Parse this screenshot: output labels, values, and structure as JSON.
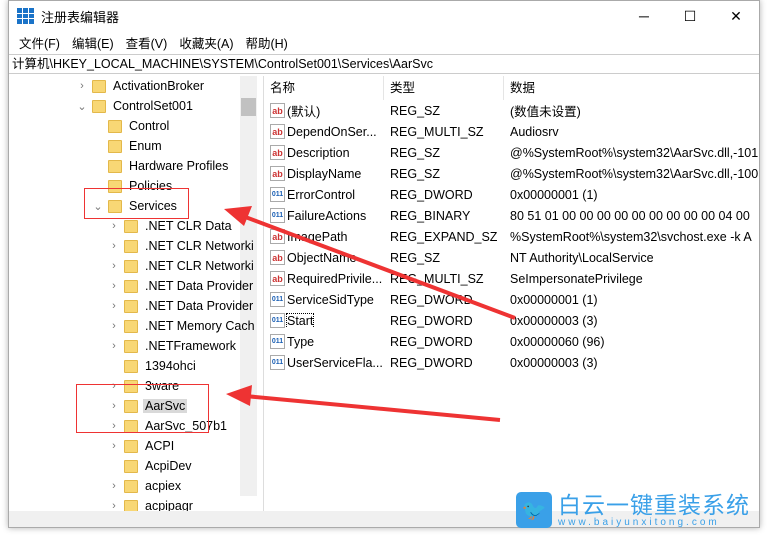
{
  "window": {
    "title": "注册表编辑器",
    "minimize": "─",
    "maximize": "☐",
    "close": "✕"
  },
  "menu": [
    "文件(F)",
    "编辑(E)",
    "查看(V)",
    "收藏夹(A)",
    "帮助(H)"
  ],
  "address": "计算机\\HKEY_LOCAL_MACHINE\\SYSTEM\\ControlSet001\\Services\\AarSvc",
  "tree": [
    {
      "label": "ActivationBroker",
      "level": 0,
      "expander": "collapsed"
    },
    {
      "label": "ControlSet001",
      "level": 0,
      "expander": "expanded"
    },
    {
      "label": "Control",
      "level": 1,
      "expander": "none"
    },
    {
      "label": "Enum",
      "level": 1,
      "expander": "none"
    },
    {
      "label": "Hardware Profiles",
      "level": 1,
      "expander": "none"
    },
    {
      "label": "Policies",
      "level": 1,
      "expander": "none"
    },
    {
      "label": "Services",
      "level": 1,
      "expander": "expanded"
    },
    {
      "label": ".NET CLR Data",
      "level": 2,
      "expander": "collapsed"
    },
    {
      "label": ".NET CLR Networki",
      "level": 2,
      "expander": "collapsed"
    },
    {
      "label": ".NET CLR Networki",
      "level": 2,
      "expander": "collapsed"
    },
    {
      "label": ".NET Data Provider",
      "level": 2,
      "expander": "collapsed"
    },
    {
      "label": ".NET Data Provider",
      "level": 2,
      "expander": "collapsed"
    },
    {
      "label": ".NET Memory Cach",
      "level": 2,
      "expander": "collapsed"
    },
    {
      "label": ".NETFramework",
      "level": 2,
      "expander": "collapsed"
    },
    {
      "label": "1394ohci",
      "level": 2,
      "expander": "none"
    },
    {
      "label": "3ware",
      "level": 2,
      "expander": "collapsed"
    },
    {
      "label": "AarSvc",
      "level": 2,
      "expander": "collapsed",
      "selected": true
    },
    {
      "label": "AarSvc_507b1",
      "level": 2,
      "expander": "collapsed"
    },
    {
      "label": "ACPI",
      "level": 2,
      "expander": "collapsed"
    },
    {
      "label": "AcpiDev",
      "level": 2,
      "expander": "none"
    },
    {
      "label": "acpiex",
      "level": 2,
      "expander": "collapsed"
    },
    {
      "label": "acpipagr",
      "level": 2,
      "expander": "collapsed"
    }
  ],
  "list": {
    "headers": [
      "名称",
      "类型",
      "数据"
    ],
    "rows": [
      {
        "icon": "string-value-icon",
        "name": "(默认)",
        "type": "REG_SZ",
        "data": "(数值未设置)"
      },
      {
        "icon": "string-value-icon",
        "name": "DependOnSer...",
        "type": "REG_MULTI_SZ",
        "data": "Audiosrv"
      },
      {
        "icon": "string-value-icon",
        "name": "Description",
        "type": "REG_SZ",
        "data": "@%SystemRoot%\\system32\\AarSvc.dll,-101"
      },
      {
        "icon": "string-value-icon",
        "name": "DisplayName",
        "type": "REG_SZ",
        "data": "@%SystemRoot%\\system32\\AarSvc.dll,-100"
      },
      {
        "icon": "binary-value-icon",
        "name": "ErrorControl",
        "type": "REG_DWORD",
        "data": "0x00000001 (1)"
      },
      {
        "icon": "binary-value-icon",
        "name": "FailureActions",
        "type": "REG_BINARY",
        "data": "80 51 01 00 00 00 00 00 00 00 00 00 04 00"
      },
      {
        "icon": "string-value-icon",
        "name": "ImagePath",
        "type": "REG_EXPAND_SZ",
        "data": "%SystemRoot%\\system32\\svchost.exe -k A"
      },
      {
        "icon": "string-value-icon",
        "name": "ObjectName",
        "type": "REG_SZ",
        "data": "NT Authority\\LocalService"
      },
      {
        "icon": "string-value-icon",
        "name": "RequiredPrivile...",
        "type": "REG_MULTI_SZ",
        "data": "SeImpersonatePrivilege"
      },
      {
        "icon": "binary-value-icon",
        "name": "ServiceSidType",
        "type": "REG_DWORD",
        "data": "0x00000001 (1)"
      },
      {
        "icon": "binary-value-icon",
        "name": "Start",
        "type": "REG_DWORD",
        "data": "0x00000003 (3)",
        "focused": true
      },
      {
        "icon": "binary-value-icon",
        "name": "Type",
        "type": "REG_DWORD",
        "data": "0x00000060 (96)"
      },
      {
        "icon": "binary-value-icon",
        "name": "UserServiceFla...",
        "type": "REG_DWORD",
        "data": "0x00000003 (3)"
      }
    ]
  },
  "watermark": {
    "title": "白云一键重装系统",
    "url": "www.baiyunxitong.com"
  },
  "colors": {
    "annotation": "#e33333",
    "watermark": "#3aa0e8",
    "folder": "#f8d775"
  }
}
